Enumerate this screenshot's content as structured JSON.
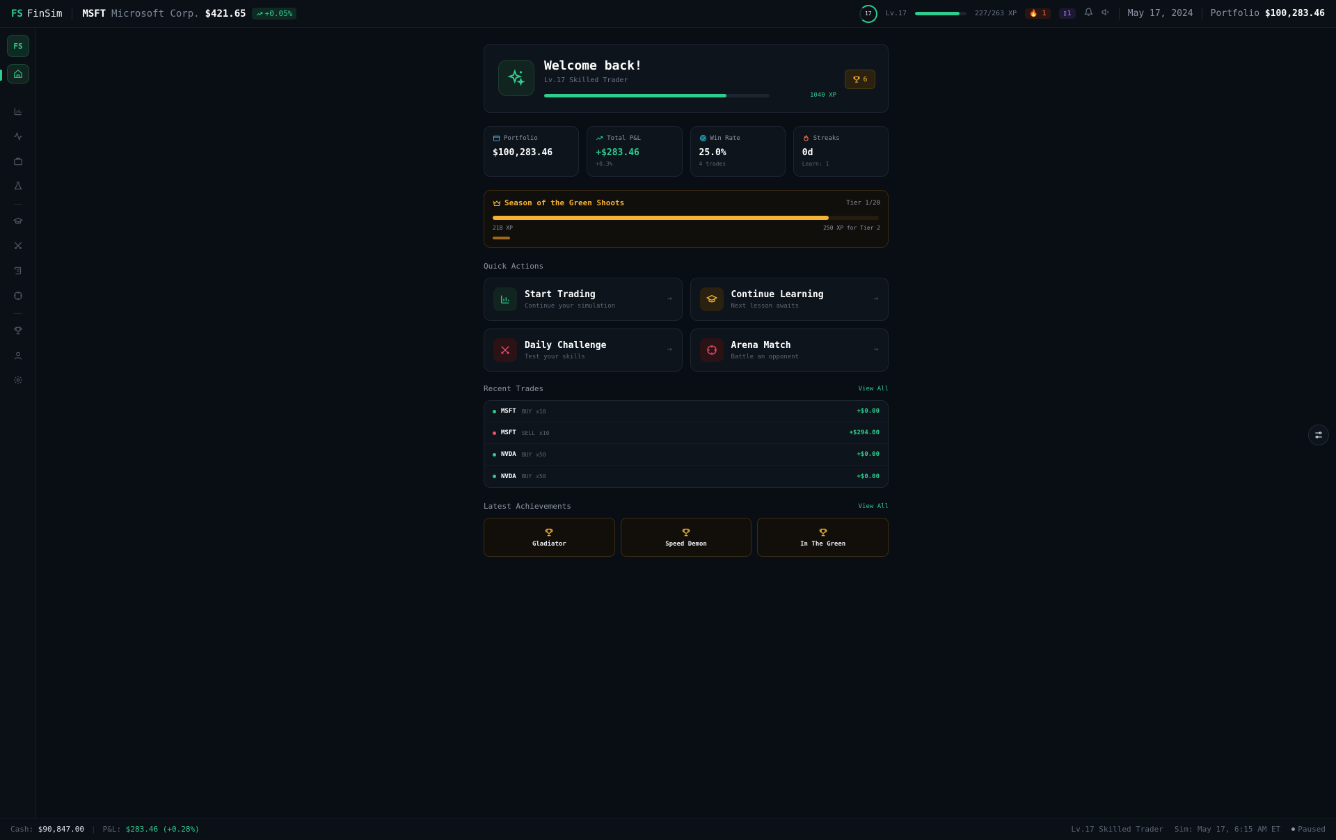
{
  "app": {
    "logo": "FS",
    "name": "FinSim"
  },
  "ticker": {
    "symbol": "MSFT",
    "company": "Microsoft Corp.",
    "price": "$421.65",
    "change": "+0.05%"
  },
  "topbar": {
    "level_ring": "17",
    "level_label": "Lv.17",
    "xp_progress": 0.863,
    "xp_text": "227/263 XP",
    "streak_count": "1",
    "learn_count": "1",
    "date": "May 17, 2024",
    "portfolio_label": "Portfolio",
    "portfolio_value": "$100,283.46"
  },
  "sidebar": {
    "logo": "FS",
    "items": [
      {
        "name": "home",
        "icon": "home-icon"
      },
      {
        "name": "charts",
        "icon": "bar-chart-icon"
      },
      {
        "name": "activity",
        "icon": "activity-icon"
      },
      {
        "name": "portfolio",
        "icon": "briefcase-icon"
      },
      {
        "name": "lab",
        "icon": "flask-icon"
      },
      {
        "name": "learn",
        "icon": "graduation-cap-icon"
      },
      {
        "name": "challenge",
        "icon": "swords-icon"
      },
      {
        "name": "history",
        "icon": "scroll-icon"
      },
      {
        "name": "arena",
        "icon": "crosshair-icon"
      },
      {
        "name": "achievements",
        "icon": "trophy-icon"
      },
      {
        "name": "profile",
        "icon": "user-icon"
      },
      {
        "name": "settings",
        "icon": "gear-icon"
      }
    ]
  },
  "welcome": {
    "title": "Welcome back!",
    "subtitle": "Lv.17 Skilled Trader",
    "progress": 0.81,
    "xp": "1040 XP",
    "trophy_count": "6"
  },
  "stats": [
    {
      "label": "Portfolio",
      "value": "$100,283.46",
      "sub": "",
      "icon": "wallet-icon",
      "color": "#5aa9e6"
    },
    {
      "label": "Total P&L",
      "value": "+$283.46",
      "sub": "+0.3%",
      "icon": "trending-up-icon",
      "color": "#2ecc8f"
    },
    {
      "label": "Win Rate",
      "value": "25.0%",
      "sub": "4 trades",
      "icon": "target-icon",
      "color": "#22b8cf"
    },
    {
      "label": "Streaks",
      "value": "0d",
      "sub": "Learn: 1",
      "icon": "flame-icon",
      "color": "#ff7a45"
    }
  ],
  "season": {
    "title": "Season of the Green Shoots",
    "tier": "Tier 1/20",
    "progress": 0.87,
    "xp": "218 XP",
    "next": "250 XP for Tier 2"
  },
  "quick_actions": {
    "title": "Quick Actions",
    "items": [
      {
        "name": "Start Trading",
        "sub": "Continue your simulation",
        "icon": "bar-chart-icon",
        "tone": "green"
      },
      {
        "name": "Continue Learning",
        "sub": "Next lesson awaits",
        "icon": "graduation-cap-icon",
        "tone": "amber"
      },
      {
        "name": "Daily Challenge",
        "sub": "Test your skills",
        "icon": "swords-icon",
        "tone": "red"
      },
      {
        "name": "Arena Match",
        "sub": "Battle an opponent",
        "icon": "crosshair-icon",
        "tone": "red"
      }
    ]
  },
  "recent_trades": {
    "title": "Recent Trades",
    "view_all": "View All",
    "rows": [
      {
        "symbol": "MSFT",
        "side": "BUY",
        "qty": "x10",
        "pnl": "+$0.00",
        "type": "buy"
      },
      {
        "symbol": "MSFT",
        "side": "SELL",
        "qty": "x10",
        "pnl": "+$294.00",
        "type": "sell"
      },
      {
        "symbol": "NVDA",
        "side": "BUY",
        "qty": "x50",
        "pnl": "+$0.00",
        "type": "buy"
      },
      {
        "symbol": "NVDA",
        "side": "BUY",
        "qty": "x50",
        "pnl": "+$0.00",
        "type": "buy"
      }
    ]
  },
  "achievements": {
    "title": "Latest Achievements",
    "view_all": "View All",
    "items": [
      {
        "name": "Gladiator"
      },
      {
        "name": "Speed Demon"
      },
      {
        "name": "In The Green"
      }
    ]
  },
  "statusbar": {
    "cash_label": "Cash:",
    "cash": "$90,847.00",
    "pnl_label": "P&L:",
    "pnl": "$283.46 (+0.28%)",
    "rank": "Lv.17 Skilled Trader",
    "sim_time": "Sim: May 17, 6:15 AM ET",
    "state": "Paused"
  }
}
